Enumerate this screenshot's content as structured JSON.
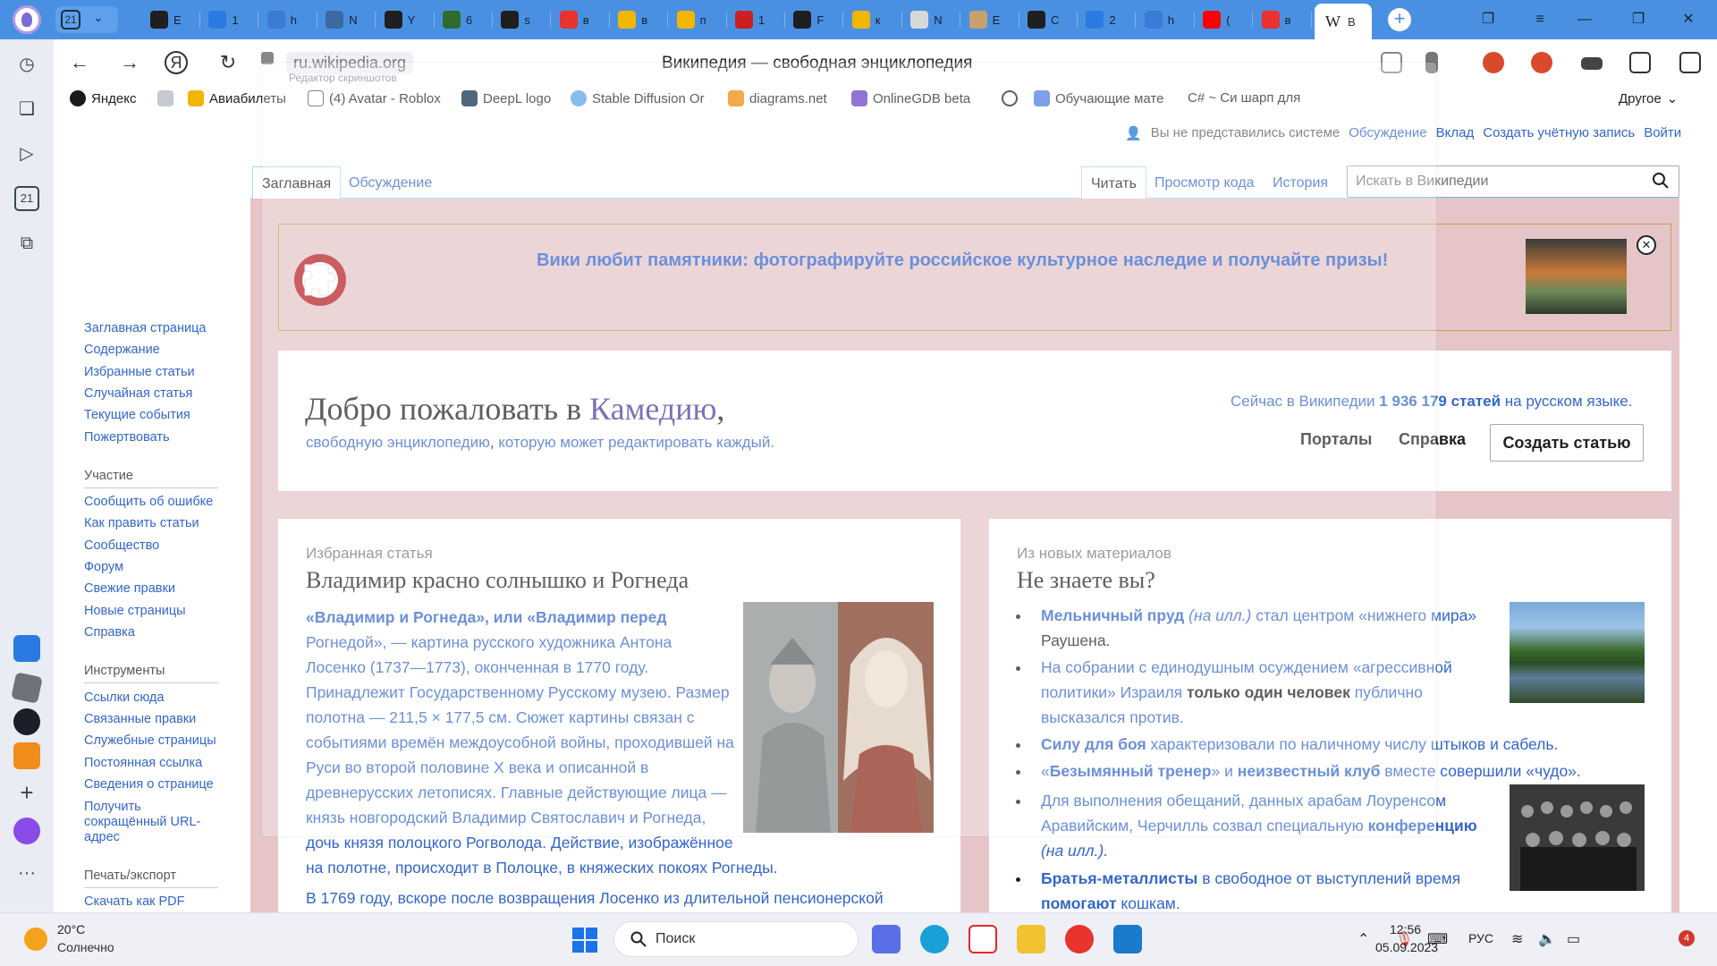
{
  "browser": {
    "tab_group_count": "21",
    "tabs": [
      {
        "label": "Е",
        "color": "#1f1f1f",
        "icon": "openai-icon"
      },
      {
        "label": "1",
        "color": "#2a7ae2",
        "icon": "edge-icon"
      },
      {
        "label": "h",
        "color": "#3c7ad8",
        "icon": "doc-icon"
      },
      {
        "label": "N",
        "color": "#3c6aa0",
        "icon": "python-icon"
      },
      {
        "label": "Y",
        "color": "#1f1f1f",
        "icon": "github-icon"
      },
      {
        "label": "6",
        "color": "#2f6b2f",
        "icon": "acmp-icon"
      },
      {
        "label": "s",
        "color": "#1f1f1f",
        "icon": "github-icon"
      },
      {
        "label": "в",
        "color": "#e8332f",
        "icon": "yandex-icon"
      },
      {
        "label": "в",
        "color": "#f2b600",
        "icon": "image-icon"
      },
      {
        "label": "п",
        "color": "#f2b600",
        "icon": "image-icon"
      },
      {
        "label": "1",
        "color": "#cc1f1f",
        "icon": "book-icon"
      },
      {
        "label": "F",
        "color": "#1f1f1f",
        "icon": "github-icon"
      },
      {
        "label": "к",
        "color": "#f2b600",
        "icon": "image-icon"
      },
      {
        "label": "N",
        "color": "#d8d8d8",
        "icon": "page-icon"
      },
      {
        "label": "Е",
        "color": "#c8a070",
        "icon": "folder-icon"
      },
      {
        "label": "С",
        "color": "#1f1f1f",
        "icon": "openai-icon"
      },
      {
        "label": "2",
        "color": "#2a7ae2",
        "icon": "edge-icon"
      },
      {
        "label": "h",
        "color": "#3c7ad8",
        "icon": "doc-icon"
      },
      {
        "label": "(",
        "color": "#ff0000",
        "icon": "youtube-icon"
      },
      {
        "label": "в",
        "color": "#e8332f",
        "icon": "yandex-icon"
      }
    ],
    "active_tab": {
      "logo": "W",
      "label": "В"
    },
    "url": "ru.wikipedia.org",
    "page_title": "Википедия — свободная энциклопедия",
    "overlay_title": "Редактор скриншотов"
  },
  "bookmarks": {
    "items": [
      "Яндекс",
      "Авиабилеты",
      "(4) Avatar - Roblox",
      "DeepL logo",
      "Stable Diffusion Or",
      "diagrams.net",
      "OnlineGDB beta",
      "Обучающие мате",
      "C# ~ Си шарп для"
    ],
    "other": "Другое"
  },
  "wiki": {
    "personal": {
      "not_logged": "Вы не представились системе",
      "talk": "Обсуждение",
      "contrib": "Вклад",
      "create_account": "Создать учётную запись",
      "login": "Войти"
    },
    "tabs": {
      "main": "Заглавная",
      "talk": "Обсуждение",
      "read": "Читать",
      "source": "Просмотр кода",
      "history": "История"
    },
    "search_placeholder": "Искать в Википедии",
    "nav": {
      "main": [
        "Заглавная страница",
        "Содержание",
        "Избранные статьи",
        "Случайная статья",
        "Текущие события",
        "Пожертвовать"
      ],
      "participation_heading": "Участие",
      "participation": [
        "Сообщить об ошибке",
        "Как править статьи",
        "Сообщество",
        "Форум",
        "Свежие правки",
        "Новые страницы",
        "Справка"
      ],
      "tools_heading": "Инструменты",
      "tools": [
        "Ссылки сюда",
        "Связанные правки",
        "Служебные страницы",
        "Постоянная ссылка",
        "Сведения о странице",
        "Получить",
        "сокращённый URL-",
        "адрес"
      ],
      "print_heading": "Печать/экспорт",
      "print": [
        "Скачать как PDF"
      ]
    },
    "banner": {
      "text": "Вики любит памятники: фотографируйте российское культурное наследие и получайте призы!"
    },
    "welcome": {
      "prefix": "Добро пожаловать в ",
      "name": "Камедию",
      "suffix": ",",
      "sub_a": "свободную энциклопедию",
      "sub_b": ", ",
      "sub_c": "которую",
      "sub_d": " может редактировать каждый.",
      "count_a": "Сейчас в Википедии ",
      "count_b": "1 936 179 статей",
      "count_c": " на русском языке.",
      "portals": "Порталы",
      "help": "Справка",
      "create": "Создать статью"
    },
    "featured": {
      "label": "Избранная статья",
      "title": "Владимир красно солнышко и Рогнеда",
      "lines": [
        "«Владимир и Рогнеда», или «Владимир перед",
        "Рогнедой», — картина русского художника Антона",
        "Лосенко (1737—1773), оконченная в 1770 году.",
        "Принадлежит Государственному Русскому музею. Размер",
        "полотна — 211,5 × 177,5 см. Сюжет картины связан с",
        "событиями времён междоусобной войны, проходившей на",
        "Руси во второй половине X века и описанной в",
        "древнерусских летописях. Главные действующие лица —",
        "князь новгородский Владимир Святославич и Рогнеда,",
        "дочь князя полоцкого Рогволода. Действие, изображённое",
        "на полотне, происходит в Полоцке, в княжеских покоях Рогнеды.",
        "В 1769 году, вскоре после возвращения Лосенко из длительной пенсионерской"
      ]
    },
    "dyk": {
      "label": "Из новых материалов",
      "title": "Не знаете вы?",
      "items": [
        [
          "Мельничный пруд",
          " (на илл.)",
          " стал центром «нижнего мира»",
          "Раушена."
        ],
        [
          "На собрании с единодушным осуждением «агрессивной",
          "политики» Израиля ",
          "только один человек",
          " публично",
          "высказался против."
        ],
        [
          "Силу для боя",
          " характеризовали по наличному числу штыков и сабель."
        ],
        [
          "«",
          "Безымянный тренер",
          "» и ",
          "неизвестный клуб",
          " вместе совершили «чудо»."
        ],
        [
          "Для выполнения обещаний, данных арабам Лоуренсом",
          "Аравийским, Черчилль созвал специальную ",
          "конференцию",
          "(на илл.)."
        ],
        [
          "Братья-металлисты",
          " в свободное от выступлений время",
          "помогают",
          " кошкам."
        ]
      ]
    }
  },
  "taskbar": {
    "weather_temp": "20°C",
    "weather_text": "Солнечно",
    "search": "Поиск",
    "lang": "РУС",
    "time": "12:56",
    "date": "05.09.2023",
    "notifications": "4"
  }
}
